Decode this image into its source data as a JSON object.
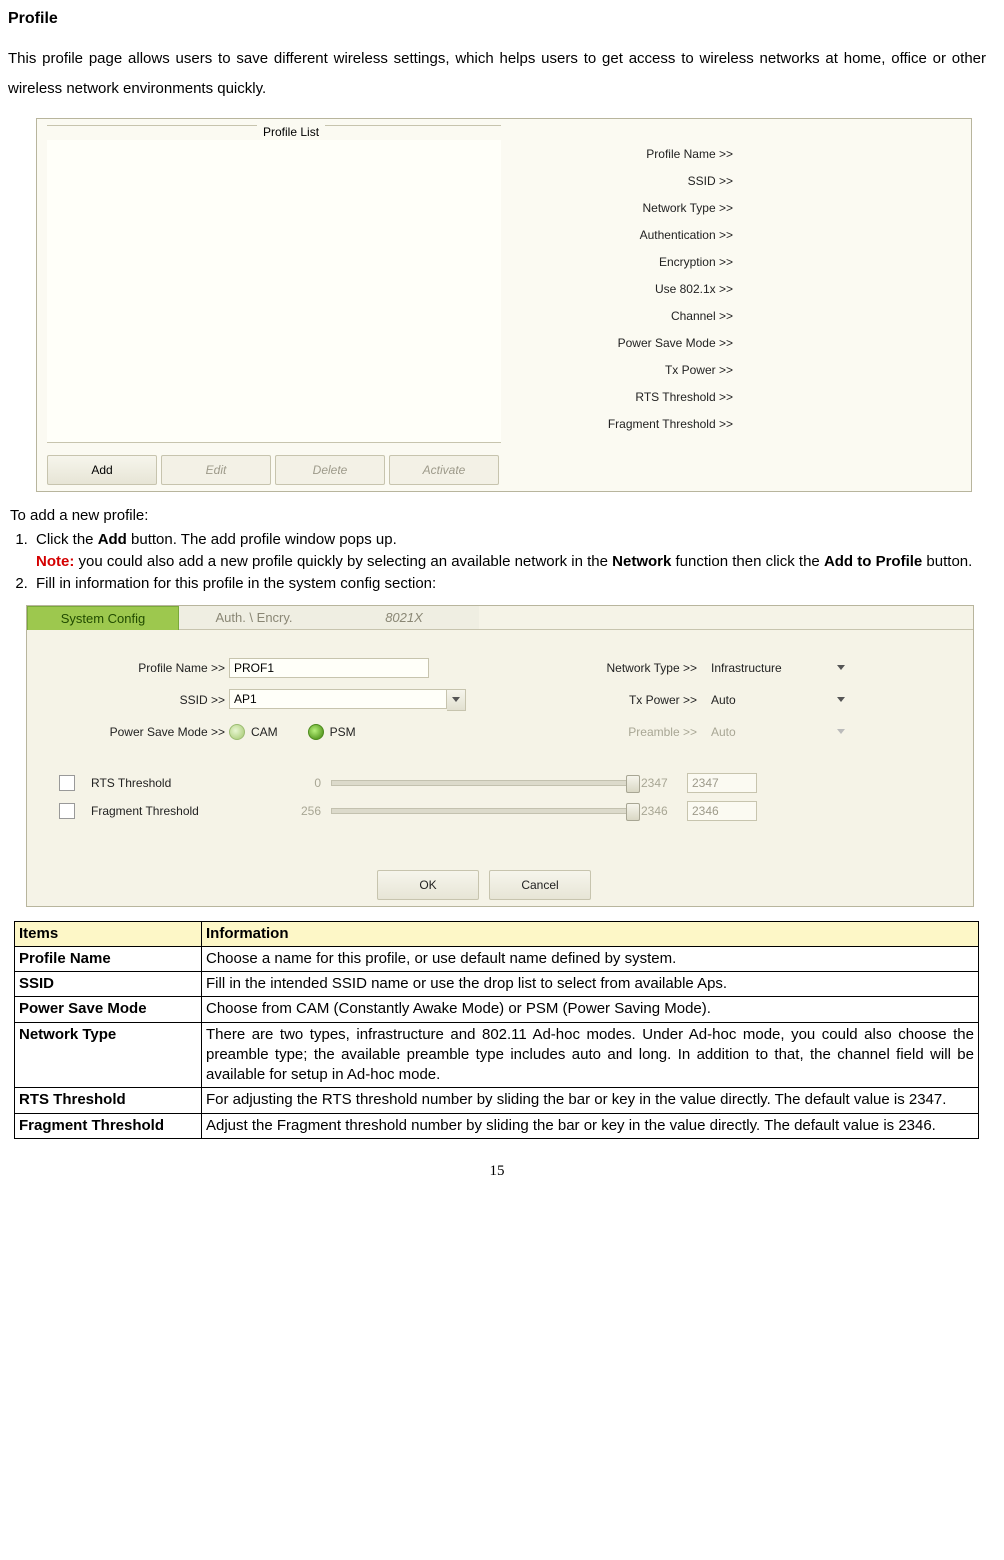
{
  "doc": {
    "title": "Profile",
    "intro": "This profile page allows users to save different wireless settings, which helps users to get access to wireless networks at home, office or other wireless network environments quickly.",
    "toadd": "To add a new profile:",
    "step1a": "Click the ",
    "step1b": " button. The add profile window pops up.",
    "add_bold": "Add",
    "note_label": "Note:",
    "note_txt1": " you could also add a new profile quickly by selecting an available network in the ",
    "network_bold": "Network",
    "note_txt2": " function then click the ",
    "addtoprofile_bold": "Add to Profile",
    "note_txt3": " button.",
    "step2": "Fill in information for this profile in the system config section:",
    "page": "15"
  },
  "fig1": {
    "legend": "Profile List",
    "props": [
      "Profile Name >>",
      "SSID >>",
      "Network Type >>",
      "Authentication >>",
      "Encryption >>",
      "Use 802.1x >>",
      "Channel >>",
      "Power Save Mode >>",
      "Tx Power >>",
      "RTS Threshold >>",
      "Fragment Threshold >>"
    ],
    "btn_add": "Add",
    "btn_edit": "Edit",
    "btn_delete": "Delete",
    "btn_activate": "Activate"
  },
  "fig2": {
    "tab1": "System Config",
    "tab2": "Auth. \\ Encry.",
    "tab3": "8021X",
    "lblProfile": "Profile Name >>",
    "valProfile": "PROF1",
    "lblSSID": "SSID >>",
    "valSSID": "AP1",
    "lblPSM": "Power Save Mode >>",
    "radCAM": "CAM",
    "radPSM": "PSM",
    "lblNet": "Network Type >>",
    "valNet": "Infrastructure",
    "lblTx": "Tx Power >>",
    "valTx": "Auto",
    "lblPre": "Preamble >>",
    "valPre": "Auto",
    "chkRTS": "RTS Threshold",
    "chkFrag": "Fragment Threshold",
    "rtsMin": "0",
    "rtsMax": "2347",
    "rtsVal": "2347",
    "fragMin": "256",
    "fragMax": "2346",
    "fragVal": "2346",
    "btnOK": "OK",
    "btnCancel": "Cancel"
  },
  "table": {
    "h1": "Items",
    "h2": "Information",
    "rows": [
      {
        "item": "Profile Name",
        "desc": "Choose a name for this profile, or use default name defined by system."
      },
      {
        "item": "SSID",
        "desc": "Fill in the intended SSID name or use the drop list to select from available Aps."
      },
      {
        "item": "Power Save Mode",
        "desc": "Choose from CAM (Constantly Awake Mode) or PSM (Power Saving Mode)."
      },
      {
        "item": "Network Type",
        "desc": "There are two types, infrastructure and 802.11 Ad-hoc modes. Under Ad-hoc mode, you could also choose the preamble type; the available preamble type includes auto and long. In addition to that, the channel field will be available for setup in Ad-hoc mode."
      },
      {
        "item": "RTS Threshold",
        "desc": "For adjusting the RTS threshold number by sliding the bar or key in the value directly. The default value is 2347."
      },
      {
        "item": "Fragment Threshold",
        "desc": "Adjust the Fragment threshold number by sliding the bar or key in the value directly. The default value is 2346."
      }
    ]
  }
}
